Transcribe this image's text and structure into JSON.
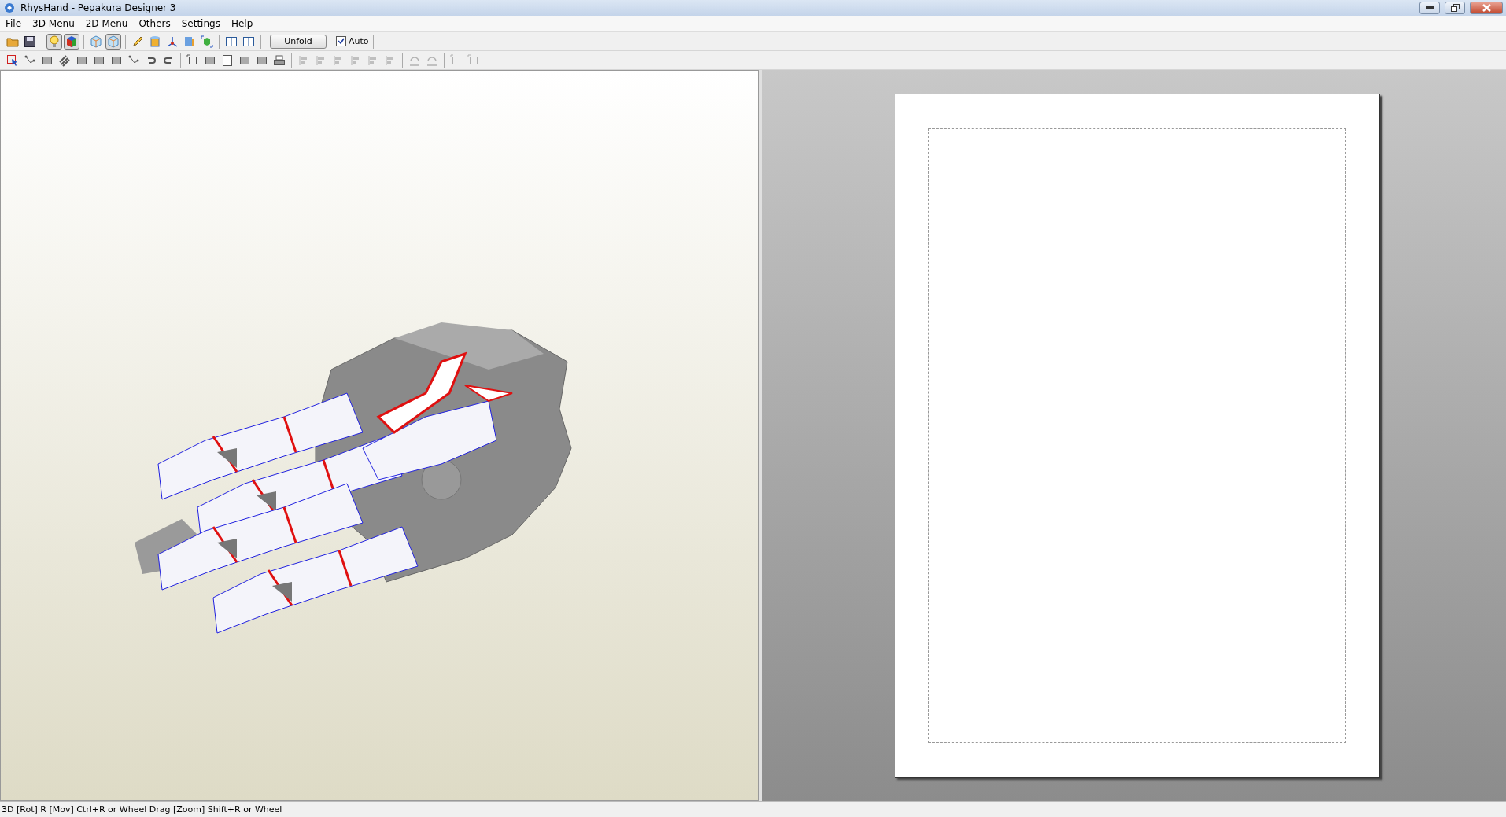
{
  "window": {
    "title": "RhysHand - Pepakura Designer 3"
  },
  "menu": [
    "File",
    "3D Menu",
    "2D Menu",
    "Others",
    "Settings",
    "Help"
  ],
  "toolbar": [
    {
      "kind": "folder",
      "pressed": false
    },
    {
      "kind": "save",
      "pressed": false
    },
    {
      "kind": "sep"
    },
    {
      "kind": "bulb",
      "pressed": true
    },
    {
      "kind": "cube",
      "pressed": true
    },
    {
      "kind": "sep"
    },
    {
      "kind": "box",
      "pressed": false
    },
    {
      "kind": "box",
      "pressed": true
    },
    {
      "kind": "sep"
    },
    {
      "kind": "pencil",
      "pressed": false
    },
    {
      "kind": "cylinder",
      "pressed": false
    },
    {
      "kind": "axes",
      "pressed": false
    },
    {
      "kind": "panel",
      "pressed": false
    },
    {
      "kind": "green",
      "pressed": false
    },
    {
      "kind": "sep"
    },
    {
      "kind": "window",
      "pressed": false
    },
    {
      "kind": "window",
      "pressed": false
    },
    {
      "kind": "sep"
    }
  ],
  "unfold_button": "Unfold",
  "auto_checkbox": {
    "label": "Auto",
    "checked": true
  },
  "toolbar2": [
    {
      "kind": "select",
      "disabled": false
    },
    {
      "kind": "node",
      "disabled": false
    },
    {
      "kind": "tile",
      "disabled": false
    },
    {
      "kind": "stripes",
      "disabled": false
    },
    {
      "kind": "tile",
      "disabled": false
    },
    {
      "kind": "tile",
      "disabled": false
    },
    {
      "kind": "tile",
      "disabled": false
    },
    {
      "kind": "node",
      "disabled": false
    },
    {
      "kind": "undo",
      "disabled": false
    },
    {
      "kind": "redo",
      "disabled": false
    },
    {
      "kind": "sep"
    },
    {
      "kind": "frame",
      "disabled": false
    },
    {
      "kind": "tile",
      "disabled": false
    },
    {
      "kind": "page",
      "disabled": false
    },
    {
      "kind": "tile",
      "disabled": false
    },
    {
      "kind": "tile",
      "disabled": false
    },
    {
      "kind": "printer",
      "disabled": false
    },
    {
      "kind": "sep"
    },
    {
      "kind": "align",
      "disabled": true
    },
    {
      "kind": "align",
      "disabled": true
    },
    {
      "kind": "align",
      "disabled": true
    },
    {
      "kind": "align",
      "disabled": true
    },
    {
      "kind": "align",
      "disabled": true
    },
    {
      "kind": "align",
      "disabled": true
    },
    {
      "kind": "sep"
    },
    {
      "kind": "rotate",
      "disabled": true
    },
    {
      "kind": "rotate",
      "disabled": true
    },
    {
      "kind": "sep"
    },
    {
      "kind": "frame",
      "disabled": true
    },
    {
      "kind": "frame",
      "disabled": true
    }
  ],
  "status_bar": "3D [Rot] R [Mov] Ctrl+R or Wheel Drag [Zoom] Shift+R or Wheel"
}
